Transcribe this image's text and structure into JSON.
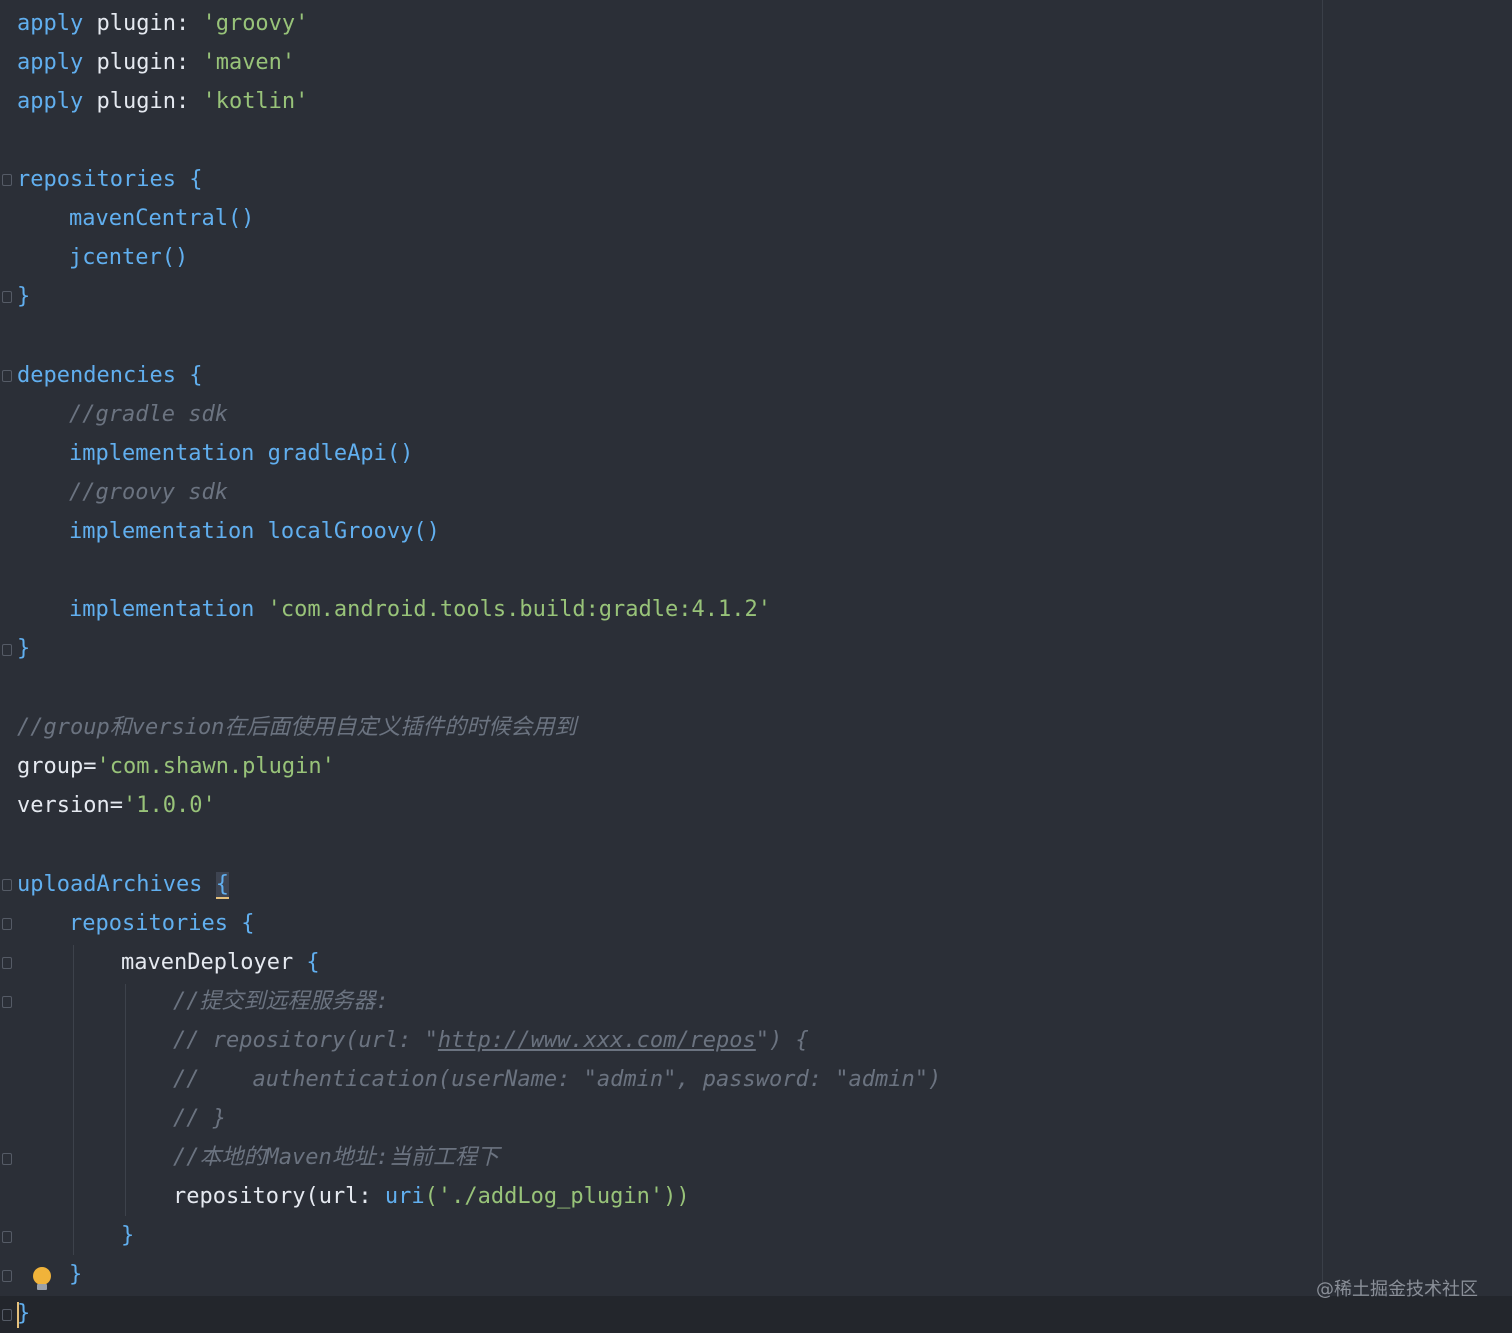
{
  "editor": {
    "lines": {
      "l1": {
        "kw": "apply",
        "mid": " plugin: ",
        "str": "'groovy'"
      },
      "l2": {
        "kw": "apply",
        "mid": " plugin: ",
        "str": "'maven'"
      },
      "l3": {
        "kw": "apply",
        "mid": " plugin: ",
        "str": "'kotlin'"
      },
      "l5": {
        "kw": "repositories",
        "brace": " {"
      },
      "l6": {
        "fn": "mavenCentral()"
      },
      "l7": {
        "fn": "jcenter()"
      },
      "l8": {
        "brace": "}"
      },
      "l10": {
        "kw": "dependencies",
        "brace": " {"
      },
      "l11": {
        "cm": "//gradle sdk"
      },
      "l12": {
        "kw": "implementation",
        "fn": " gradleApi()"
      },
      "l13": {
        "cm": "//groovy sdk"
      },
      "l14": {
        "kw": "implementation",
        "fn": " localGroovy()"
      },
      "l16": {
        "kw": "implementation",
        "str": " 'com.android.tools.build:gradle:4.1.2'"
      },
      "l17": {
        "brace": "}"
      },
      "l19": {
        "cm": "//group和version在后面使用自定义插件的时候会用到"
      },
      "l20": {
        "plain": "group=",
        "str": "'com.shawn.plugin'"
      },
      "l21": {
        "plain": "version=",
        "str": "'1.0.0'"
      },
      "l23": {
        "kw": "uploadArchives",
        "sp": " ",
        "brace": "{"
      },
      "l24": {
        "kw": "repositories",
        "brace": " {"
      },
      "l25": {
        "plain": "mavenDeployer",
        "brace": " {"
      },
      "l26": {
        "cm": "//提交到远程服务器:"
      },
      "l27": {
        "cm1": "// repository(url: \"",
        "link": "http://www.xxx.com/repos",
        "cm2": "\") {"
      },
      "l28": {
        "cm": "//    authentication(userName: \"admin\", password: \"admin\")"
      },
      "l29": {
        "cm": "// }"
      },
      "l30": {
        "cm": "//本地的Maven地址:当前工程下"
      },
      "l31": {
        "plain": "repository(url: ",
        "fn": "uri",
        "str": "('./addLog_plugin'))"
      },
      "l32": {
        "brace": "}"
      },
      "l33": {
        "brace": "}"
      },
      "l34": {
        "brace": "}"
      }
    }
  },
  "watermark": "@稀土掘金技术社区",
  "colors": {
    "background": "#2b2f37",
    "keyword": "#61afef",
    "string": "#98c379",
    "comment": "#6b7380",
    "text": "#e5e9f0"
  }
}
